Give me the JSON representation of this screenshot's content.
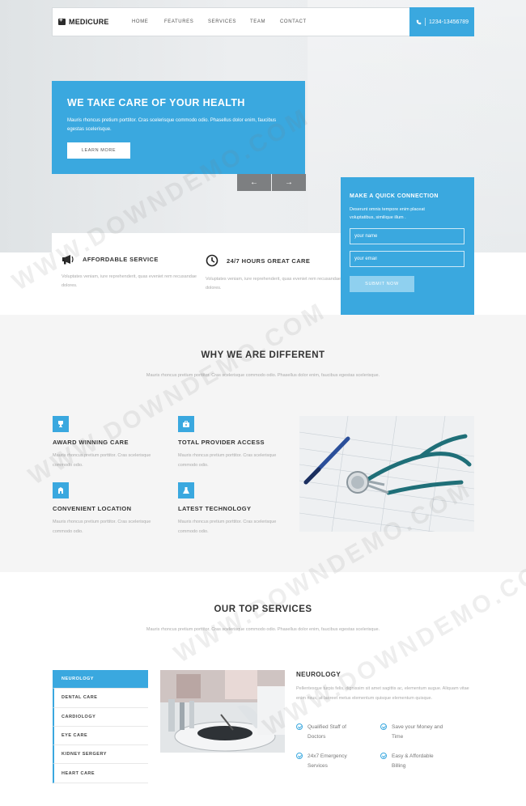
{
  "nav": {
    "logo": "MEDICURE",
    "links": [
      "HOME",
      "FEATURES",
      "SERVICES",
      "TEAM",
      "CONTACT"
    ],
    "phone": "1234-13456789"
  },
  "hero": {
    "title": "WE TAKE CARE OF YOUR HEALTH",
    "text": "Mauris rhoncus pretium porttitor. Cras scelerisque commodo odio. Phasellus dolor enim, faucibus egestas scelerisque.",
    "button": "LEARN MORE",
    "prev_arrow": "←",
    "next_arrow": "→"
  },
  "quick": {
    "title": "MAKE A QUICK CONNECTION",
    "text": "Deserunt omnis tempore enim placeat voluptatibus, similique illum .",
    "name_placeholder": "your name",
    "email_placeholder": "your email",
    "button": "SUBMIT NOW"
  },
  "features": [
    {
      "title": "AFFORDABLE SERVICE",
      "text": "Voluptates veniam, iure reprehenderit, quas eveniet rem recusandae dolores.",
      "icon": "megaphone-icon"
    },
    {
      "title": "24/7 HOURS GREAT CARE",
      "text": "Voluptates veniam, iure reprehenderit, quas eveniet rem recusandae dolores.",
      "icon": "clock-icon"
    }
  ],
  "why": {
    "title": "WHY WE ARE DIFFERENT",
    "subtitle": "Mauris rhoncus pretium porttitor. Cras scelerisque commodo odio. Phasellus dolor enim, faucibus egestas scelerisque.",
    "items": [
      {
        "title": "AWARD WINNING CARE",
        "text": "Mauris rhoncus pretium porttitor. Cras scelerisque commodo odio."
      },
      {
        "title": "TOTAL PROVIDER ACCESS",
        "text": "Mauris rhoncus pretium porttitor. Cras scelerisque commodo odio."
      },
      {
        "title": "CONVENIENT LOCATION",
        "text": "Mauris rhoncus pretium porttitor. Cras scelerisque commodo odio."
      },
      {
        "title": "LATEST TECHNOLOGY",
        "text": "Mauris rhoncus pretium porttitor. Cras scelerisque commodo odio."
      }
    ]
  },
  "services": {
    "title": "OUR TOP SERVICES",
    "subtitle": "Mauris rhoncus pretium porttitor. Cras scelerisque commodo odio. Phasellus dolor enim, faucibus egestas scelerisque.",
    "menu": [
      "NEUROLOGY",
      "DENTAL CARE",
      "CARDIOLOGY",
      "EYE CARE",
      "KIDNEY SERGERY",
      "HEART CARE"
    ],
    "detail_title": "NEUROLOGY",
    "detail_text": "Pellentesque turpis felis, dignissim sit amet sagittis ac, elementum augue. Aliquam vitae enim risus, at laoreet metus elementum quisque elementum quisque.",
    "points": [
      "Qualified Staff of Doctors",
      "Save your Money and Time",
      "24x7 Emergency Services",
      "Easy & Affordable Billing"
    ]
  },
  "watermark": "WWW.DOWNDEMO.COM",
  "accent_color": "#3aa8df"
}
